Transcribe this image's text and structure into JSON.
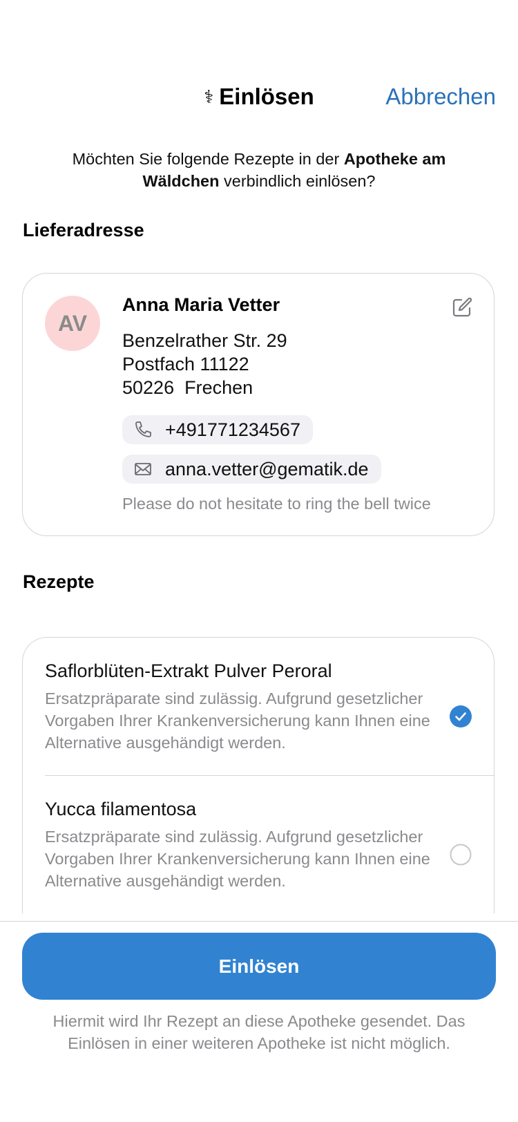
{
  "header": {
    "title": "Einlösen",
    "title_icon": "caduceus-icon",
    "cancel_label": "Abbrechen"
  },
  "intro": {
    "prefix": "Möchten Sie folgende Rezepte in der ",
    "pharmacy": "Apotheke am Wäldchen",
    "suffix": " verbindlich einlösen?"
  },
  "address_section": {
    "title": "Lieferadresse",
    "avatar_initials": "AV",
    "name": "Anna Maria Vetter",
    "street": "Benzelrather Str. 29",
    "postbox": "Postfach 11122",
    "zip": "50226",
    "city": "Frechen",
    "phone": "+491771234567",
    "email": "anna.vetter@gematik.de",
    "note": "Please do not hesitate to ring the bell twice",
    "avatar_color": "#fcd6d6"
  },
  "prescriptions": {
    "title": "Rezepte",
    "items": [
      {
        "name": "Saflorblüten-Extrakt Pulver Peroral",
        "description": "Ersatzpräparate sind zulässig. Aufgrund gesetzlicher Vorgaben Ihrer Krankenversicherung kann Ihnen eine Alternative ausgehändigt werden.",
        "selected": true
      },
      {
        "name": "Yucca filamentosa",
        "description": "Ersatzpräparate sind zulässig. Aufgrund gesetzlicher Vorgaben Ihrer Krankenversicherung kann Ihnen eine Alternative ausgehändigt werden.",
        "selected": false
      }
    ]
  },
  "footer": {
    "button_label": "Einlösen",
    "disclaimer": "Hiermit wird Ihr Rezept an diese Apotheke gesendet. Das Einlösen in einer weiteren Apotheke ist nicht möglich."
  },
  "colors": {
    "accent": "#3183d1",
    "link": "#2a72b8",
    "secondary_text": "#8a8a8e"
  }
}
